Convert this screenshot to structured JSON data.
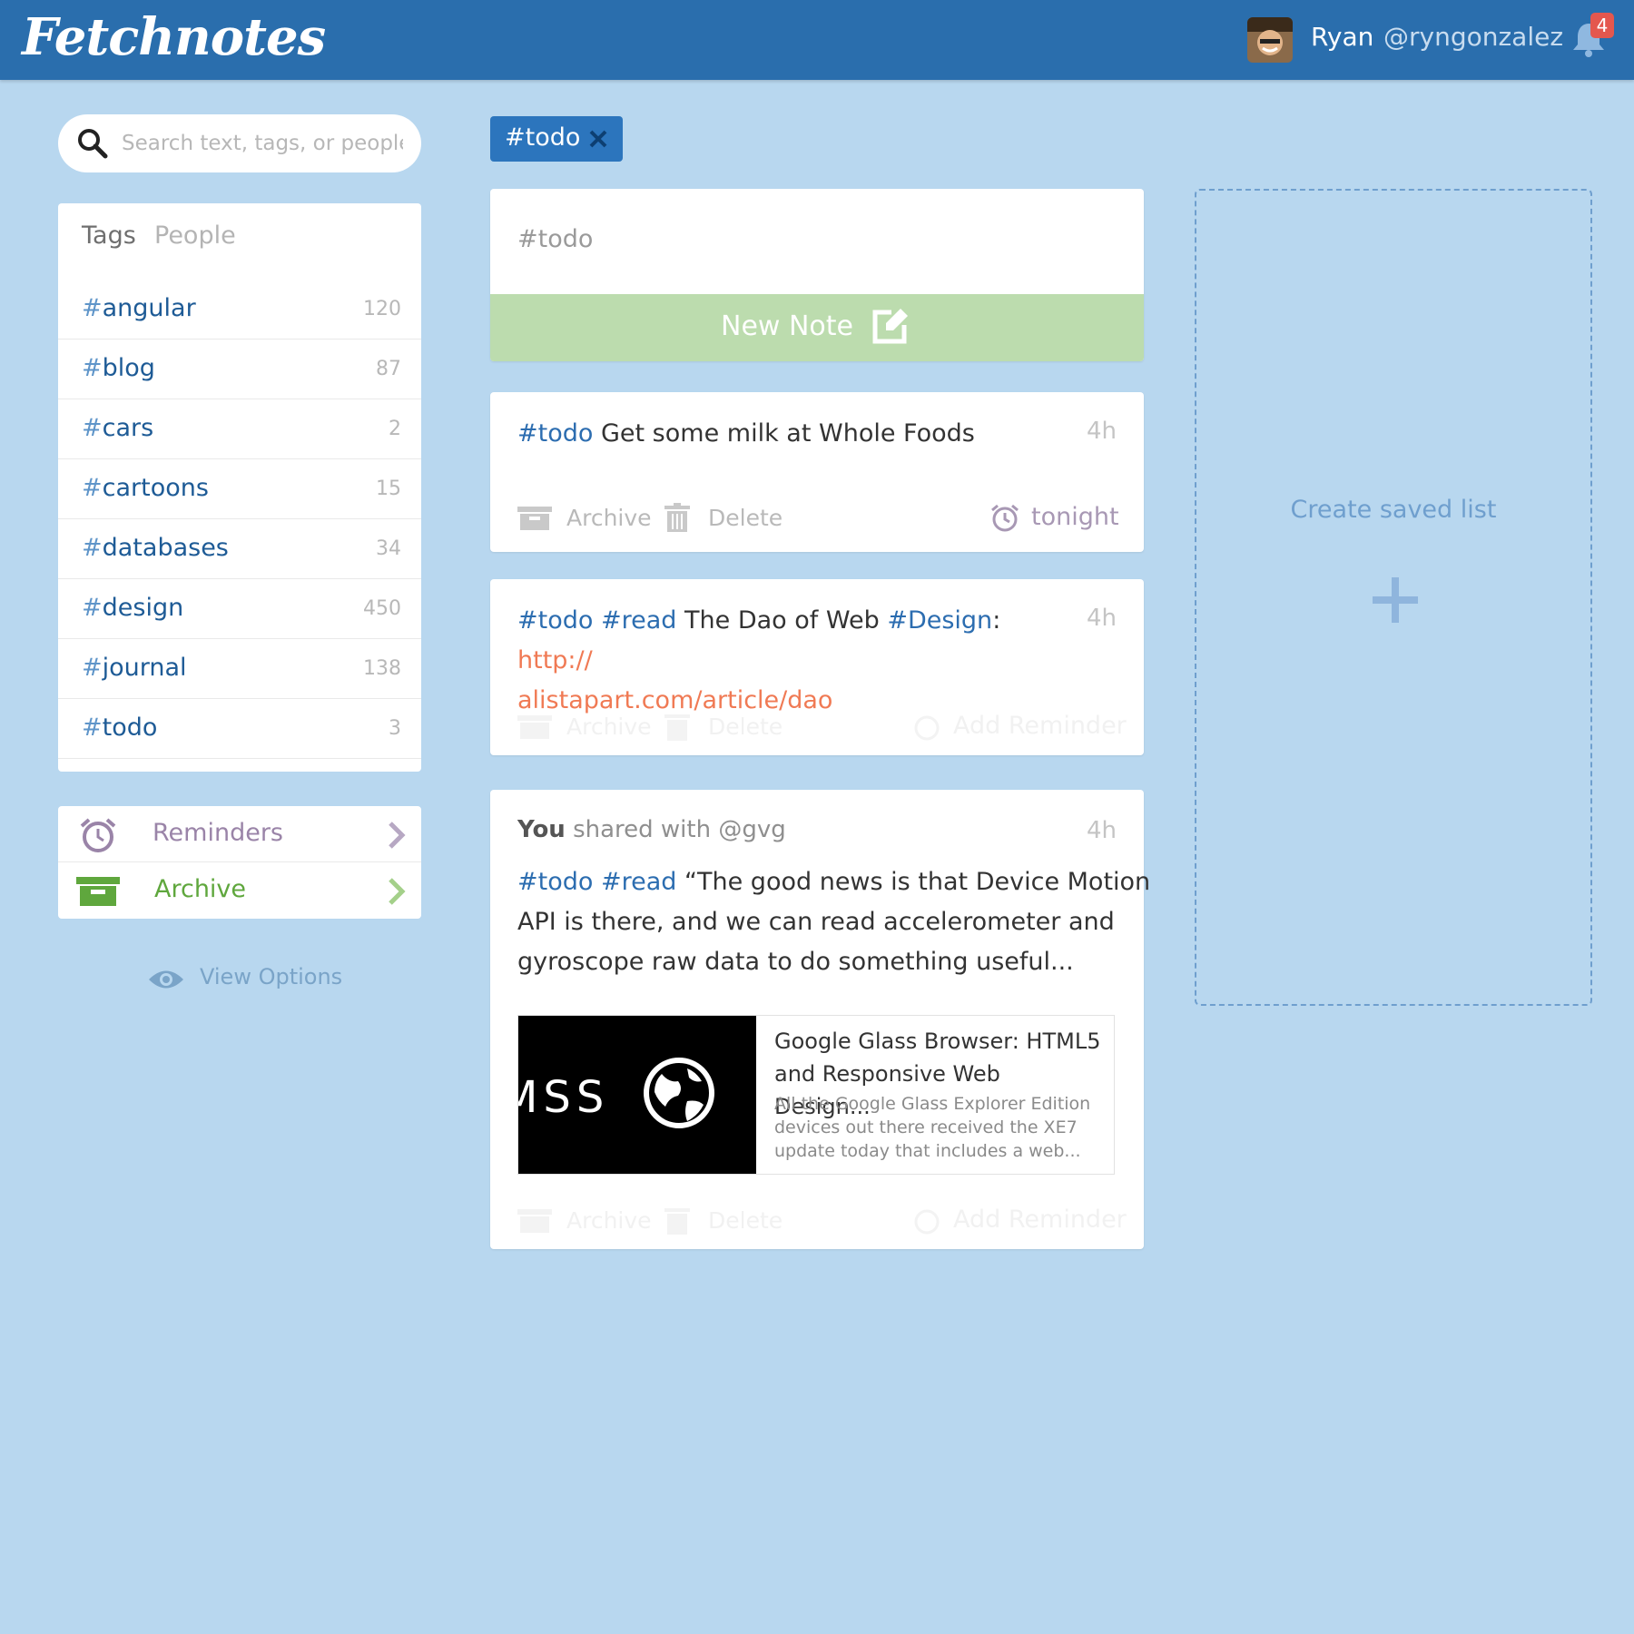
{
  "header": {
    "logo": "Fetchnotes",
    "user_name": "Ryan",
    "user_handle": "@ryngonzalez",
    "notification_count": "4"
  },
  "sidebar": {
    "search_placeholder": "Search text, tags, or people",
    "tabs": [
      {
        "label": "Tags",
        "active": true
      },
      {
        "label": "People",
        "active": false
      }
    ],
    "tags": [
      {
        "name": "angular",
        "count": "120"
      },
      {
        "name": "blog",
        "count": "87"
      },
      {
        "name": "cars",
        "count": "2"
      },
      {
        "name": "cartoons",
        "count": "15"
      },
      {
        "name": "databases",
        "count": "34"
      },
      {
        "name": "design",
        "count": "450"
      },
      {
        "name": "journal",
        "count": "138"
      },
      {
        "name": "todo",
        "count": "3"
      }
    ],
    "nav": [
      {
        "label": "Reminders",
        "color": "#9a84a8"
      },
      {
        "label": "Archive",
        "color": "#5fa73d"
      }
    ],
    "view_options": "View Options"
  },
  "filter": {
    "label": "#todo"
  },
  "composer": {
    "value": "#todo",
    "button_label": "New Note"
  },
  "notes": [
    {
      "time": "4h",
      "tag1": "#todo",
      "text": "Get some milk at Whole Foods",
      "archive": "Archive",
      "delete": "Delete",
      "reminder": "tonight"
    },
    {
      "time": "4h",
      "tag1": "#todo",
      "tag2": "#read",
      "text1": "The Dao of Web",
      "tag3": "#Design",
      "colon": ":",
      "link_part1": "http://",
      "link_part2": "alistapart.com/article/dao",
      "archive": "Archive",
      "delete": "Delete",
      "reminder": "Add Reminder"
    },
    {
      "time": "4h",
      "shared_you": "You",
      "shared_rest": "shared with @gvg",
      "tag1": "#todo",
      "tag2": "#read",
      "line1": "“The good news is that Device Motion",
      "line2": "API is there, and we can read accelerometer and",
      "line3": "gyroscope raw data to do something useful...",
      "preview_image_text": "MSS",
      "preview_title": "Google Glass Browser: HTML5 and Responsive Web Design...",
      "preview_desc": "All the Google Glass Explorer Edition devices out there received the XE7 update today that includes a web...",
      "archive": "Archive",
      "delete": "Delete",
      "reminder": "Add Reminder"
    }
  ],
  "saved_list": {
    "label": "Create saved list"
  },
  "colors": {
    "background": "#b8d7ef",
    "header": "#2a6ead",
    "tag_text": "#1e5b96",
    "new_note": "#bcdcae",
    "link": "#f07a54",
    "badge": "#e4574e"
  }
}
